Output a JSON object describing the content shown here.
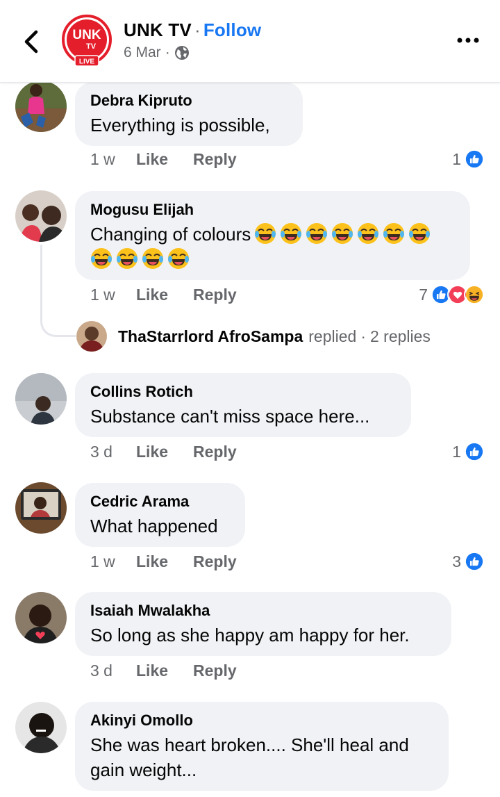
{
  "header": {
    "page_name": "UNK TV",
    "separator": "·",
    "follow_label": "Follow",
    "date": "6 Mar",
    "meta_separator": "·",
    "logo": {
      "main": "UNK",
      "sub": "TV",
      "badge": "LIVE"
    },
    "icons": [
      "back-arrow-icon",
      "globe-icon",
      "more-options-icon"
    ]
  },
  "labels": {
    "like": "Like",
    "reply": "Reply"
  },
  "comments": [
    {
      "name": "Debra Kipruto",
      "text": "Everything is possible,",
      "time": "1 w",
      "reaction_count": "1",
      "reactions": [
        "like"
      ]
    },
    {
      "name": "Mogusu Elijah",
      "text": "Changing of colours",
      "emoji": "laughing-tears-icon",
      "emoji_count": 11,
      "time": "1 w",
      "reaction_count": "7",
      "reactions": [
        "like",
        "love",
        "haha"
      ],
      "replies": {
        "replier": "ThaStarrlord AfroSampa",
        "replied_label": "replied",
        "separator": "·",
        "count_label": "2 replies"
      }
    },
    {
      "name": "Collins Rotich",
      "text": "Substance can't miss space here...",
      "time": "3 d",
      "reaction_count": "1",
      "reactions": [
        "like"
      ]
    },
    {
      "name": "Cedric Arama",
      "text": "What happened",
      "time": "1 w",
      "reaction_count": "3",
      "reactions": [
        "like"
      ]
    },
    {
      "name": "Isaiah Mwalakha",
      "text": "So long as she happy am happy for her.",
      "time": "3 d",
      "reaction_count": "",
      "reactions": []
    },
    {
      "name": "Akinyi Omollo",
      "text": "She was heart broken.... She'll heal and gain weight...",
      "time": "",
      "reaction_count": "",
      "reactions": []
    }
  ],
  "colors": {
    "accent": "#1877f2",
    "bubble": "#f0f2f5",
    "muted": "#65676b",
    "brand_red": "#e41e2b",
    "love": "#f33e58",
    "haha": "#f7b125"
  }
}
